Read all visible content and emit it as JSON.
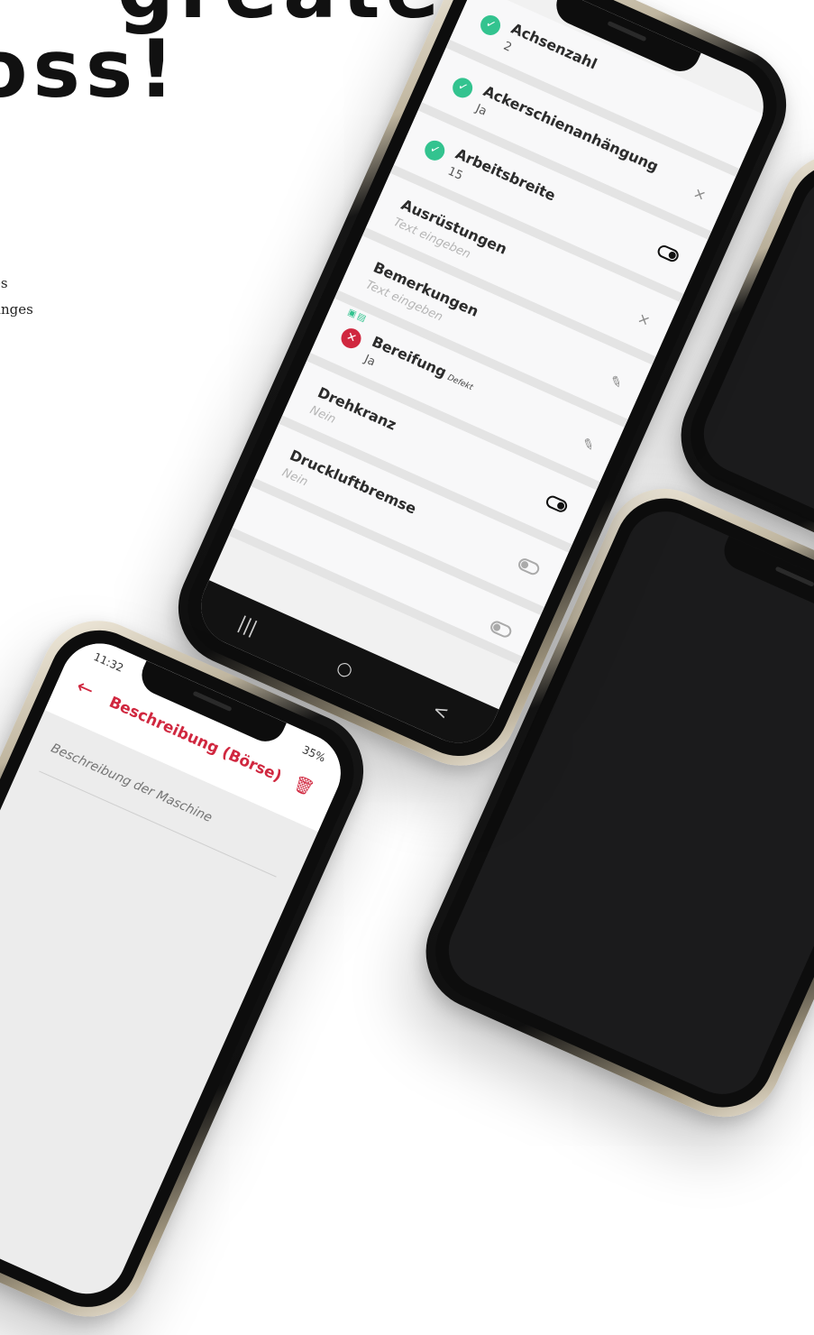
{
  "headline": {
    "line1": "greater",
    "line2": "oss!"
  },
  "body_text": {
    "line1": "es",
    "line2": "anges"
  },
  "main_phone": {
    "rows": [
      {
        "label": "Achsenzahl",
        "value": "2",
        "status": "ok",
        "control": ""
      },
      {
        "label": "Ackerschienanhängung",
        "value": "Ja",
        "status": "ok",
        "control": "×"
      },
      {
        "label": "Arbeitsbreite",
        "value": "15",
        "status": "ok",
        "control": "toggle-on"
      },
      {
        "label": "Ausrüstungen",
        "value": "Text eingeben",
        "status": "",
        "control": "×"
      },
      {
        "label": "Bemerkungen",
        "value": "Text eingeben",
        "status": "",
        "control": "pencil"
      },
      {
        "label": "Bereifung",
        "tag": "Defekt",
        "value": "Ja",
        "status": "error",
        "control": "pencil"
      },
      {
        "label": "Drehkranz",
        "value": "Nein",
        "status": "",
        "control": "toggle-on"
      },
      {
        "label": "Druckluftbremse",
        "value": "Nein",
        "status": "",
        "control": "toggle-off"
      }
    ],
    "nav": {
      "recent": "|||",
      "home": "○",
      "back": "<"
    },
    "extra_toggle": "toggle-off"
  },
  "desc_phone": {
    "time": "11:32",
    "status": "35%",
    "title": "Beschreibung (Börse)",
    "placeholder": "Beschreibung der Maschine"
  },
  "colors": {
    "accent_green": "#33c38f",
    "accent_red": "#d0273f"
  }
}
